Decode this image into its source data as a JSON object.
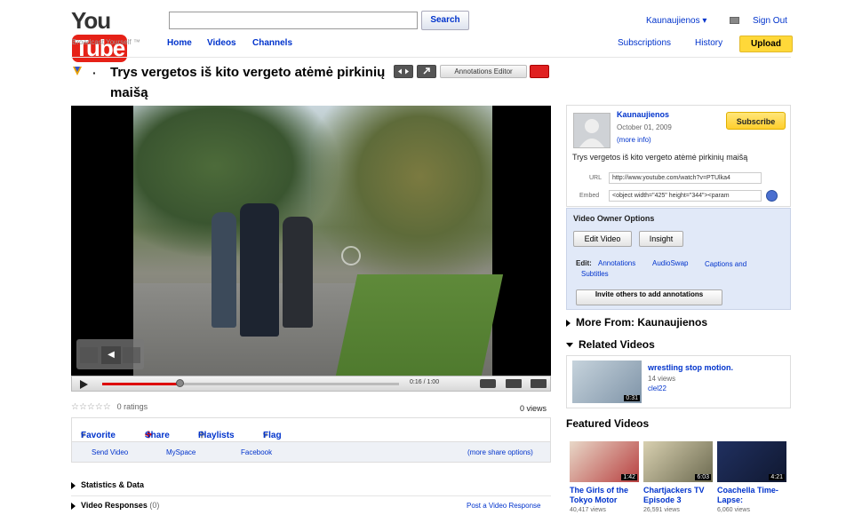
{
  "header": {
    "logo_you": "You",
    "logo_tube": "Tube",
    "tagline": "Broadcast Yourself ™",
    "search_button": "Search",
    "search_value": "",
    "nav": [
      "Home",
      "Videos",
      "Channels"
    ],
    "user": "Kaunaujienos ▾",
    "sign_out": "Sign Out",
    "subscriptions": "Subscriptions",
    "history": "History",
    "upload": "Upload"
  },
  "video": {
    "title": "Trys vergetos iš kito vergeto atėmė pirkinių maišą",
    "annotations_editor": "Annotations Editor",
    "time": "0:16 / 1:00",
    "progress_fraction": 0.26,
    "ratings": "0 ratings",
    "views": "0 views"
  },
  "actions": {
    "favorite": "Favorite",
    "share": "Share",
    "playlists": "Playlists",
    "flag": "Flag"
  },
  "share_links": {
    "send_video": "Send Video",
    "myspace": "MySpace",
    "facebook": "Facebook",
    "more": "(more share options)"
  },
  "sections_left": {
    "stats": "Statistics & Data",
    "responses": "Video Responses",
    "responses_count": "(0)",
    "post_response": "Post a Video Response"
  },
  "owner": {
    "name": "Kaunaujienos",
    "date": "October 01, 2009",
    "more_info": "(more info)",
    "description": "Trys vergetos iš kito vergeto atėmė pirkinių maišą",
    "subscribe": "Subscribe",
    "url_label": "URL",
    "url_value": "http://www.youtube.com/watch?v=PTUlka4",
    "embed_label": "Embed",
    "embed_value": "<object width=\"425\" height=\"344\"><param"
  },
  "owner_options": {
    "heading": "Video Owner Options",
    "edit_video": "Edit Video",
    "insight": "Insight",
    "edit_label": "Edit:",
    "annotations": "Annotations",
    "audioswap": "AudioSwap",
    "captions": "Captions and Subtitles",
    "invite": "Invite others to add annotations"
  },
  "sidebar_sections": {
    "more_from": "More From: Kaunaujienos",
    "related": "Related Videos",
    "featured": "Featured Videos"
  },
  "related": [
    {
      "title": "wrestling stop motion.",
      "views": "14 views",
      "user": "clel22",
      "duration": "0:31"
    }
  ],
  "featured": [
    {
      "title": "The Girls of the Tokyo Motor",
      "views": "40,417 views",
      "duration": "1:42"
    },
    {
      "title": "Chartjackers TV Episode 3",
      "views": "26,591 views",
      "duration": "6:03"
    },
    {
      "title": "Coachella Time-Lapse:",
      "views": "6,060 views",
      "duration": "4:21"
    }
  ]
}
